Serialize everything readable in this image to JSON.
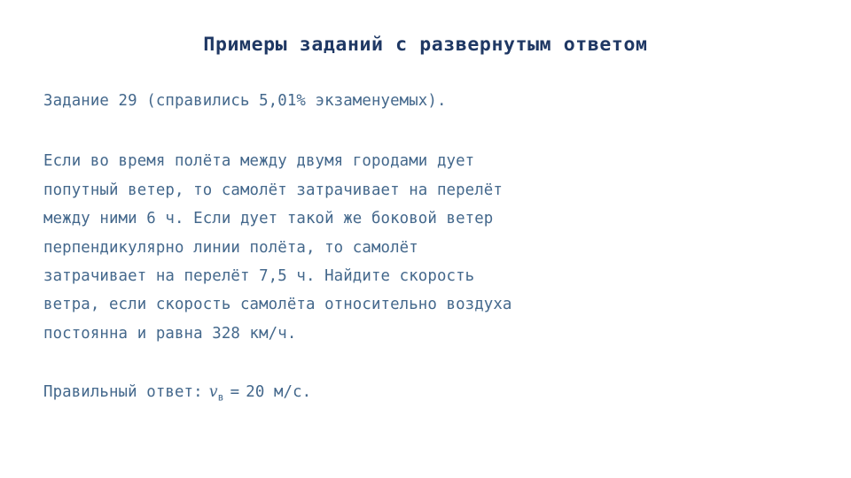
{
  "slide": {
    "title": "Примеры заданий с развернутым ответом",
    "title_color": "#1f3864",
    "body_color": "#44688c",
    "background_color": "#ffffff",
    "task_header": "Задание 29 (справились 5,01% экзаменуемых).",
    "problem_lines": [
      "Если во время полёта между двумя городами дует",
      "попутный ветер, то самолёт затрачивает на перелёт",
      "между ними 6 ч. Если дует такой же боковой ветер",
      "перпендикулярно линии полёта, то самолёт",
      "затрачивает на перелёт 7,5 ч. Найдите скорость",
      "ветра, если скорость самолёта относительно воздуха",
      "постоянна и равна 328 км/ч."
    ],
    "answer": {
      "label": "Правильный ответ:",
      "variable": "v",
      "variable_subscript": "в",
      "equals": "=",
      "value": "20 м/с."
    }
  }
}
